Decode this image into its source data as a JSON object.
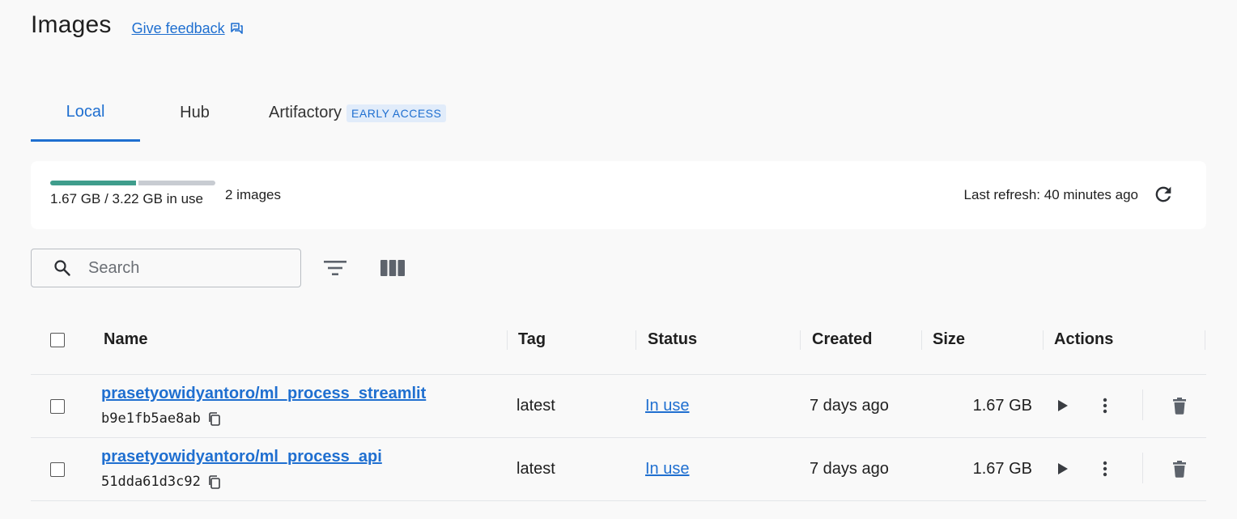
{
  "header": {
    "title": "Images",
    "feedback_label": "Give feedback"
  },
  "tabs": [
    {
      "label": "Local",
      "active": true
    },
    {
      "label": "Hub",
      "active": false
    },
    {
      "label": "Artifactory",
      "badge": "EARLY ACCESS",
      "active": false
    }
  ],
  "summary": {
    "usage_text": "1.67 GB / 3.22 GB in use",
    "usage_fraction": 0.52,
    "image_count": "2 images",
    "last_refresh": "Last refresh: 40 minutes ago"
  },
  "toolbar": {
    "search_placeholder": "Search",
    "search_value": ""
  },
  "table": {
    "columns": [
      "Name",
      "Tag",
      "Status",
      "Created",
      "Size",
      "Actions"
    ],
    "rows": [
      {
        "name": "prasetyowidyantoro/ml_process_streamlit",
        "id": "b9e1fb5ae8ab",
        "tag": "latest",
        "status": "In use",
        "created": "7 days ago",
        "size": "1.67 GB"
      },
      {
        "name": "prasetyowidyantoro/ml_process_api",
        "id": "51dda61d3c92",
        "tag": "latest",
        "status": "In use",
        "created": "7 days ago",
        "size": "1.67 GB"
      }
    ]
  },
  "icons": {
    "feedback": "feedback-icon",
    "refresh": "refresh-icon",
    "search": "search-icon",
    "filter": "filter-icon",
    "columns": "columns-icon",
    "copy": "copy-icon",
    "run": "play-icon",
    "more": "more-vertical-icon",
    "delete": "trash-icon"
  },
  "colors": {
    "accent": "#1f6fd0",
    "usage_used": "#3f9d8c",
    "usage_free": "#c8ccd2"
  }
}
